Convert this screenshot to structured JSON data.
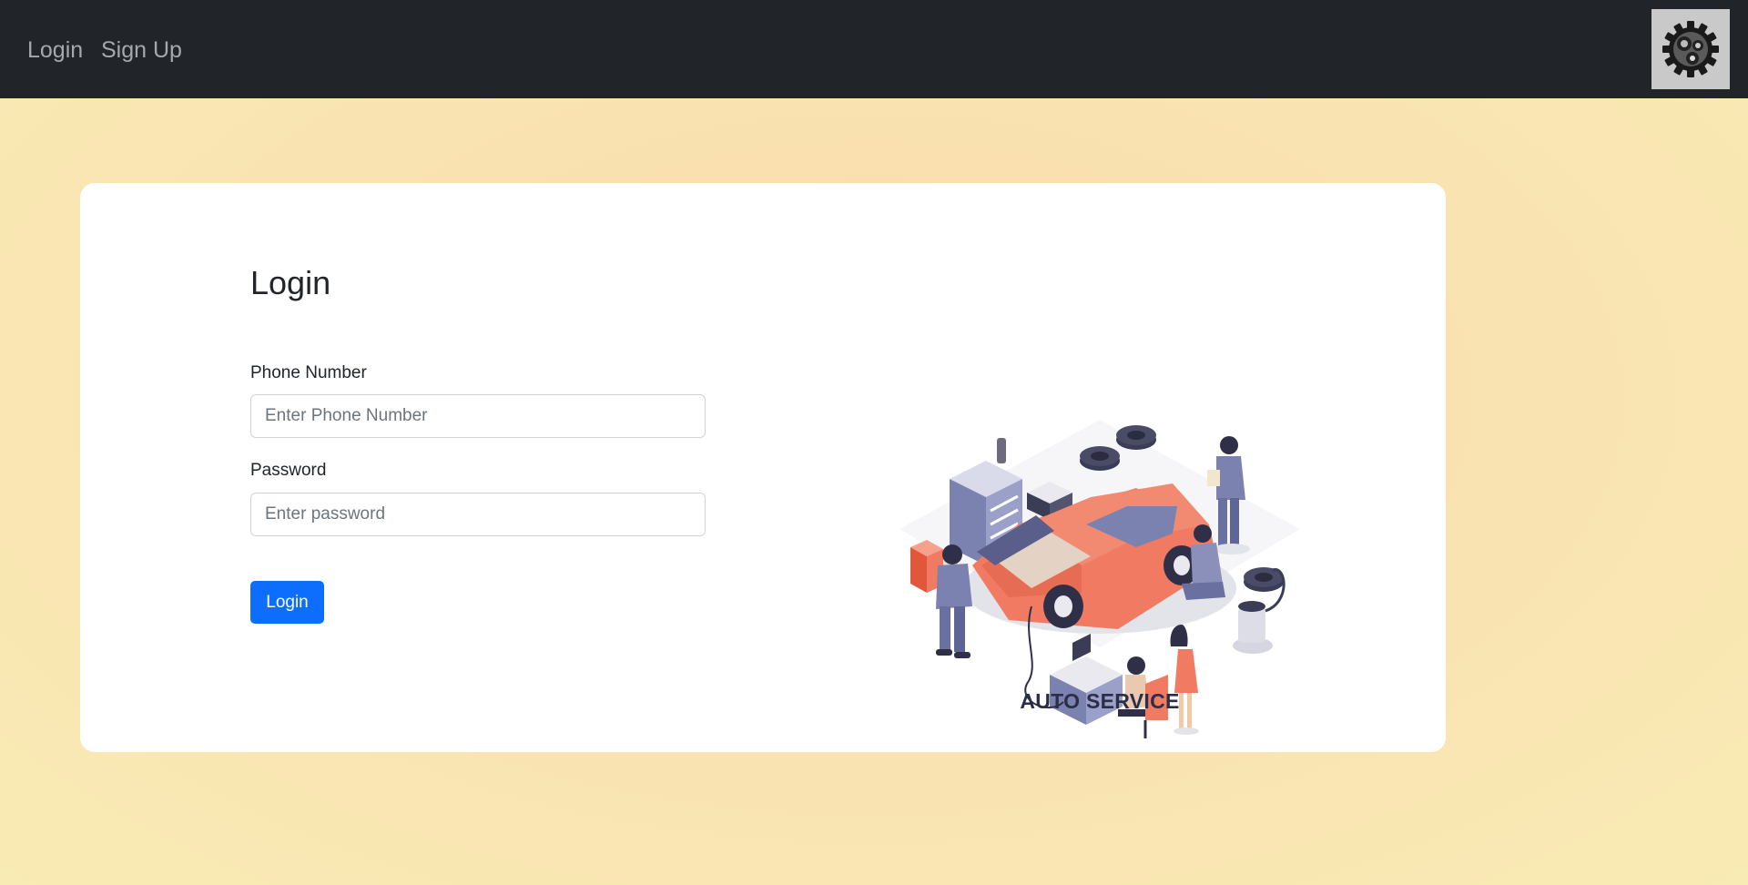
{
  "nav": {
    "login_label": "Login",
    "signup_label": "Sign Up",
    "logo_icon": "gear-icon"
  },
  "form": {
    "title": "Login",
    "phone_label": "Phone Number",
    "phone_placeholder": "Enter Phone Number",
    "phone_value": "",
    "password_label": "Password",
    "password_placeholder": "Enter password",
    "password_value": "",
    "submit_label": "Login"
  },
  "illustration": {
    "caption": "AUTO SERVICE",
    "icon": "auto-service-illustration"
  },
  "colors": {
    "navbar": "#212529",
    "primary_button": "#0d6efd",
    "car": "#f07a62",
    "background": "#f9e2b0"
  }
}
